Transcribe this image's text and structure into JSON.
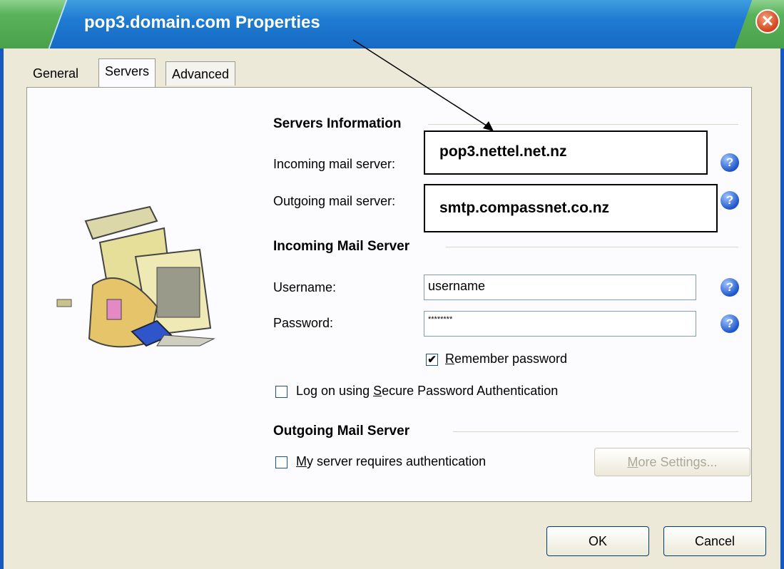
{
  "window": {
    "title": "pop3.domain.com Properties",
    "close_glyph": "✕"
  },
  "tabs": [
    {
      "label": "General"
    },
    {
      "label": "Servers"
    },
    {
      "label": "Advanced"
    }
  ],
  "servers_info": {
    "heading": "Servers Information",
    "incoming_label": "Incoming mail server:",
    "incoming_value": "pop3.nettel.net.nz",
    "outgoing_label": "Outgoing mail server:",
    "outgoing_value": "smtp.compassnet.co.nz"
  },
  "incoming": {
    "heading": "Incoming Mail Server",
    "username_label": "Username:",
    "username_value": "username",
    "password_label": "Password:",
    "password_value": "********",
    "remember": {
      "label_prefix": "",
      "label_mnemonic": "R",
      "label_rest": "emember password",
      "checked": true,
      "check_glyph": "✔"
    },
    "spa": {
      "label_prefix": "Log on using ",
      "label_mnemonic": "S",
      "label_rest": "ecure Password Authentication",
      "checked": false
    }
  },
  "outgoing": {
    "heading": "Outgoing Mail Server",
    "auth": {
      "label_prefix": "",
      "label_mnemonic": "M",
      "label_rest": "y server requires authentication",
      "checked": false
    },
    "more_settings": {
      "mnemonic": "M",
      "rest": "ore Settings..."
    }
  },
  "help_glyph": "?",
  "buttons": {
    "ok": "OK",
    "cancel": "Cancel"
  },
  "colors": {
    "title_blue": "#1f7bd2",
    "help_blue": "#1e56c8",
    "close_red": "#d0431b"
  }
}
